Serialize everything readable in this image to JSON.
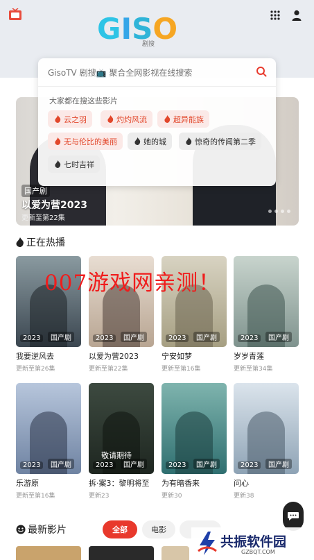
{
  "header": {
    "app_logo_text": "GISO",
    "logo_subtitle": "剧搜"
  },
  "search": {
    "placeholder": "GisoTV 剧搜📺 聚合全网影视在线搜索",
    "hot_title": "大家都在搜这些影片",
    "hot_chips": [
      {
        "label": "云之羽",
        "hot": true
      },
      {
        "label": "灼灼风流",
        "hot": true
      },
      {
        "label": "超异能族",
        "hot": true
      },
      {
        "label": "无与伦比的美丽",
        "hot": true
      },
      {
        "label": "她的城",
        "hot": false
      },
      {
        "label": "惊奇的传闻第二季",
        "hot": false
      },
      {
        "label": "七时吉祥",
        "hot": false
      }
    ]
  },
  "banner": {
    "tag": "国产剧",
    "title": "以爱为营2023",
    "subtitle": "更新至第22集"
  },
  "now_playing": {
    "section_title": "正在热播",
    "items": [
      {
        "title": "我要逆风去",
        "year": "2023",
        "genre": "国产剧",
        "update": "更新至第26集",
        "color": "#6f7f85"
      },
      {
        "title": "以爱为营2023",
        "year": "2023",
        "genre": "国产剧",
        "update": "更新至第22集",
        "color": "#c9b7a8"
      },
      {
        "title": "宁安如梦",
        "year": "2023",
        "genre": "国产剧",
        "update": "更新至第16集",
        "color": "#b9b29a"
      },
      {
        "title": "岁岁青莲",
        "year": "2023",
        "genre": "国产剧",
        "update": "更新至第34集",
        "color": "#8fa3a0"
      },
      {
        "title": "乐游原",
        "year": "2023",
        "genre": "国产剧",
        "update": "更新至第16集",
        "color": "#7c8fa8"
      },
      {
        "title": "拆·案3：黎明将至",
        "year": "2023",
        "genre": "国产剧",
        "update": "更新23",
        "color": "#5b6b5c",
        "extra": "敬请期待"
      },
      {
        "title": "为有暗香来",
        "year": "2023",
        "genre": "国产剧",
        "update": "更新30",
        "color": "#4d8a8c"
      },
      {
        "title": "问心",
        "year": "2023",
        "genre": "国产剧",
        "update": "更新38",
        "color": "#9fb3c3"
      }
    ]
  },
  "watermark": "007游戏网亲测！",
  "latest": {
    "section_title": "最新影片",
    "tabs": [
      "全部",
      "电影"
    ]
  },
  "brand": {
    "name": "共振软件园",
    "url": "GZBQT.COM"
  },
  "colors": {
    "accent": "#e8392c",
    "hot_chip_bg": "#fbe9e7",
    "hot_chip_text": "#e2472b"
  }
}
